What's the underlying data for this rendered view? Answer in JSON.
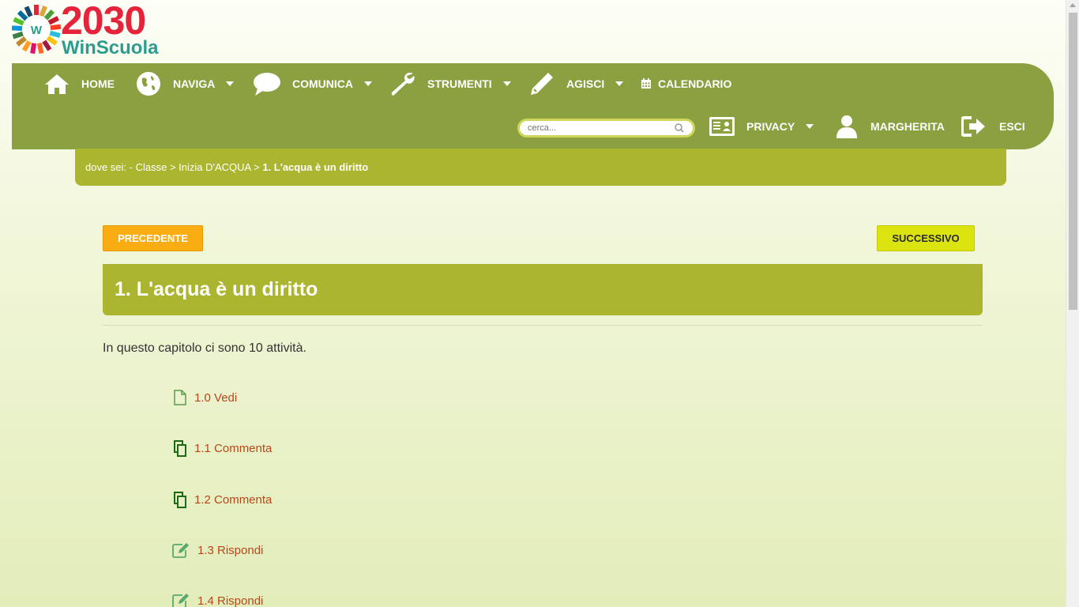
{
  "logo": {
    "number": "2030",
    "brand": "WinScuola",
    "wheel_letter": "W"
  },
  "nav": {
    "home": "HOME",
    "naviga": "NAVIGA",
    "comunica": "COMUNICA",
    "strumenti": "STRUMENTI",
    "agisci": "AGISCI",
    "calendario": "CALENDARIO",
    "privacy": "PRIVACY",
    "user": "MARGHERITA",
    "esci": "ESCI"
  },
  "search": {
    "placeholder": "cerca..."
  },
  "breadcrumb": {
    "prefix": "dove sei: - ",
    "items": [
      "Classe",
      "Inizia D'ACQUA"
    ],
    "separator": " > ",
    "current": "1. L'acqua è un diritto"
  },
  "buttons": {
    "prev": "PRECEDENTE",
    "next": "SUCCESSIVO"
  },
  "chapter": {
    "title": "1. L'acqua è un diritto",
    "intro": "In questo capitolo ci sono 10 attività."
  },
  "activities": [
    {
      "label": "1.0 Vedi",
      "icon": "page-icon"
    },
    {
      "label": "1.1 Commenta",
      "icon": "copy-icon"
    },
    {
      "label": "1.2 Commenta",
      "icon": "copy-icon"
    },
    {
      "label": "1.3 Rispondi",
      "icon": "edit-icon"
    },
    {
      "label": "1.4 Rispondi",
      "icon": "edit-icon"
    }
  ],
  "colors": {
    "navbar": "#8aa041",
    "breadcrumb": "#abb52f",
    "prev_button": "#f9ad12",
    "next_button": "#dce40f",
    "activity_link": "#b8471b"
  }
}
